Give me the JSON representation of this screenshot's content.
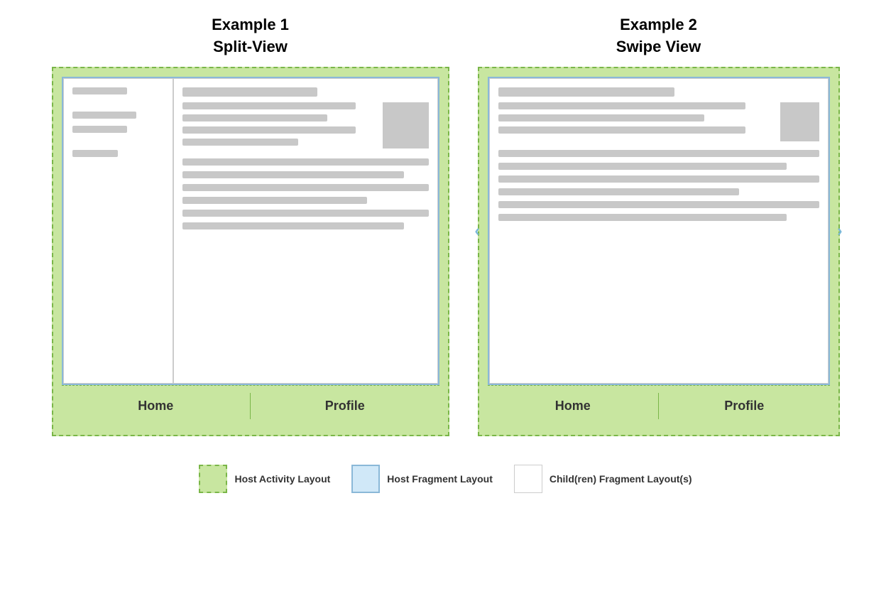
{
  "example1": {
    "title_line1": "Example 1",
    "title_line2": "Split-View",
    "nav": {
      "home": "Home",
      "profile": "Profile"
    }
  },
  "example2": {
    "title_line1": "Example 2",
    "title_line2": "Swipe View",
    "nav": {
      "home": "Home",
      "profile": "Profile"
    },
    "arrows": {
      "left": "‹",
      "right": "›"
    }
  },
  "legend": {
    "items": [
      {
        "key": "green",
        "label": "Host Activity Layout"
      },
      {
        "key": "blue",
        "label": "Host Fragment Layout"
      },
      {
        "key": "white",
        "label": "Child(ren) Fragment Layout(s)"
      }
    ]
  }
}
